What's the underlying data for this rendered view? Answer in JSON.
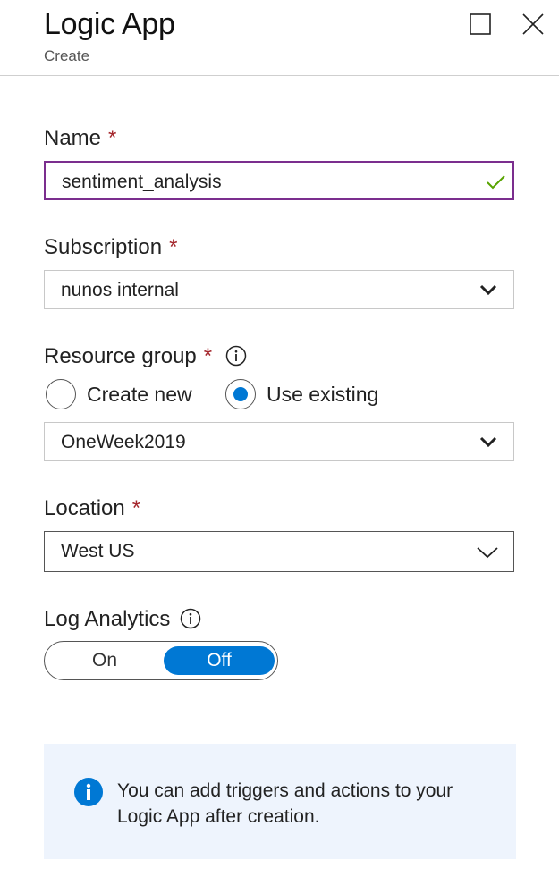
{
  "header": {
    "title": "Logic App",
    "subtitle": "Create"
  },
  "window": {
    "maximize_icon": "square-icon",
    "close_icon": "close-icon"
  },
  "form": {
    "name": {
      "label": "Name",
      "required_mark": "*",
      "value": "sentiment_analysis",
      "valid": true
    },
    "subscription": {
      "label": "Subscription",
      "required_mark": "*",
      "value": "nunos internal"
    },
    "resource_group": {
      "label": "Resource group",
      "required_mark": "*",
      "options": [
        "Create new",
        "Use existing"
      ],
      "selected": "Use existing",
      "value": "OneWeek2019"
    },
    "location": {
      "label": "Location",
      "required_mark": "*",
      "value": "West US"
    },
    "log_analytics": {
      "label": "Log Analytics",
      "on_label": "On",
      "off_label": "Off",
      "state": "Off"
    }
  },
  "info": {
    "message": "You can add triggers and actions to your Logic App after creation."
  },
  "colors": {
    "accent": "#0078d4",
    "required": "#a4262c",
    "focus_border": "#7b2e8e",
    "valid_check": "#57a300",
    "info_bg": "#eef4fd"
  }
}
